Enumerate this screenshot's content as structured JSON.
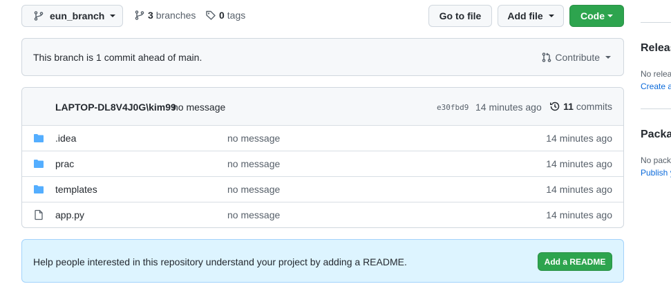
{
  "branch": {
    "name": "eun_branch"
  },
  "stats": {
    "branches_count": "3",
    "branches_label": "branches",
    "tags_count": "0",
    "tags_label": "tags"
  },
  "actions": {
    "go_to_file": "Go to file",
    "add_file": "Add file",
    "code": "Code"
  },
  "ahead_banner": {
    "text": "This branch is 1 commit ahead of main.",
    "contribute": "Contribute"
  },
  "latest_commit": {
    "author": "LAPTOP-DL8V4J0G\\kim99",
    "message": "no message",
    "sha": "e30fbd9",
    "age": "14 minutes ago",
    "commits_count": "11",
    "commits_label": "commits"
  },
  "files": [
    {
      "name": ".idea",
      "type": "folder",
      "message": "no message",
      "age": "14 minutes ago"
    },
    {
      "name": "prac",
      "type": "folder",
      "message": "no message",
      "age": "14 minutes ago"
    },
    {
      "name": "templates",
      "type": "folder",
      "message": "no message",
      "age": "14 minutes ago"
    },
    {
      "name": "app.py",
      "type": "file",
      "message": "no message",
      "age": "14 minutes ago"
    }
  ],
  "readme_banner": {
    "text": "Help people interested in this repository understand your project by adding a README.",
    "button": "Add a README"
  },
  "sidebar": {
    "releases_title": "Releas",
    "releases_text": "No relea",
    "releases_link": "Create a",
    "packages_title": "Packag",
    "packages_text": "No pack",
    "packages_link": "Publish y"
  },
  "colors": {
    "primary_green": "#2da44e",
    "folder_blue": "#54aeff",
    "link_blue": "#0969da",
    "readme_bg": "#ddf4ff"
  }
}
